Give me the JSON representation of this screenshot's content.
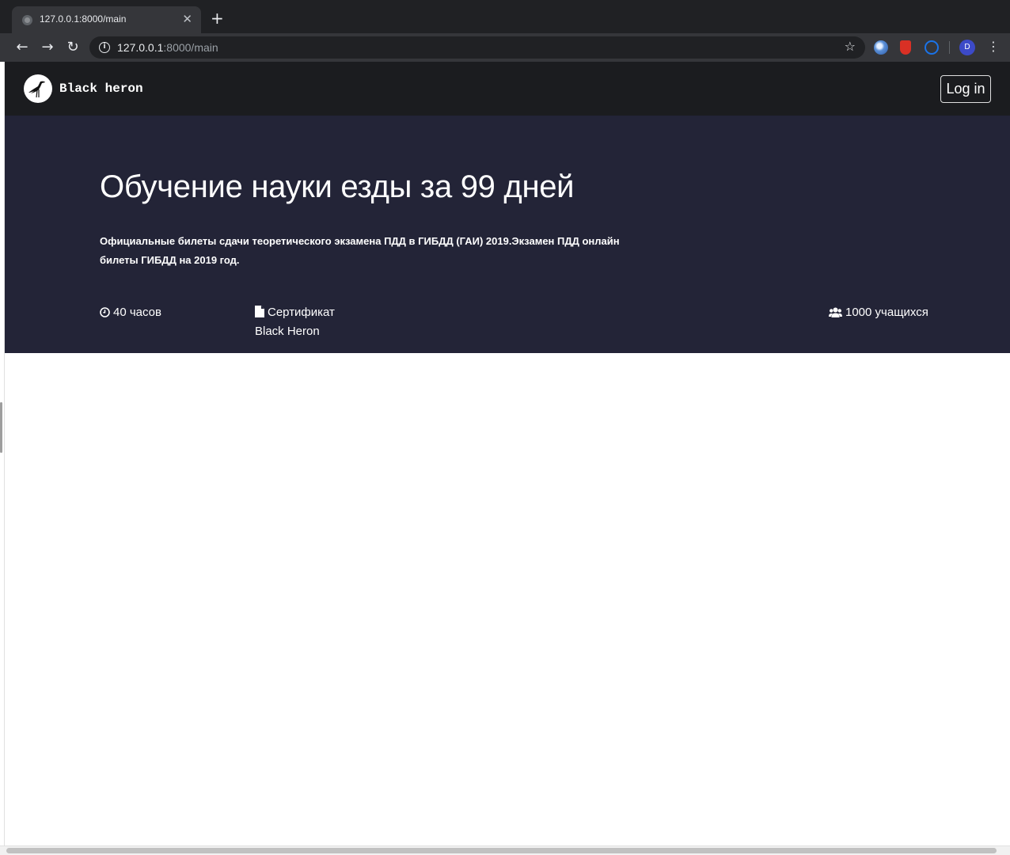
{
  "browser": {
    "tab_title": "127.0.0.1:8000/main",
    "url_host": "127.0.0.1",
    "url_rest": ":8000/main",
    "avatar_letter": "D"
  },
  "site": {
    "brand": "Black heron",
    "login_label": "Log in"
  },
  "hero": {
    "title": "Обучение науки езды за 99 дней",
    "description": "Официальные билеты сдачи теоретического экзамена ПДД в ГИБДД (ГАИ) 2019.Экзамен ПДД онлайн билеты ГИБДД на 2019 год.",
    "stats": {
      "duration": "40 часов",
      "certificate_line1": "Сертификат",
      "certificate_line2": "Black Heron",
      "students": "1000 учащихся"
    }
  },
  "colors": {
    "nav_bg": "#1b1c1f",
    "hero_bg": "#232437"
  }
}
